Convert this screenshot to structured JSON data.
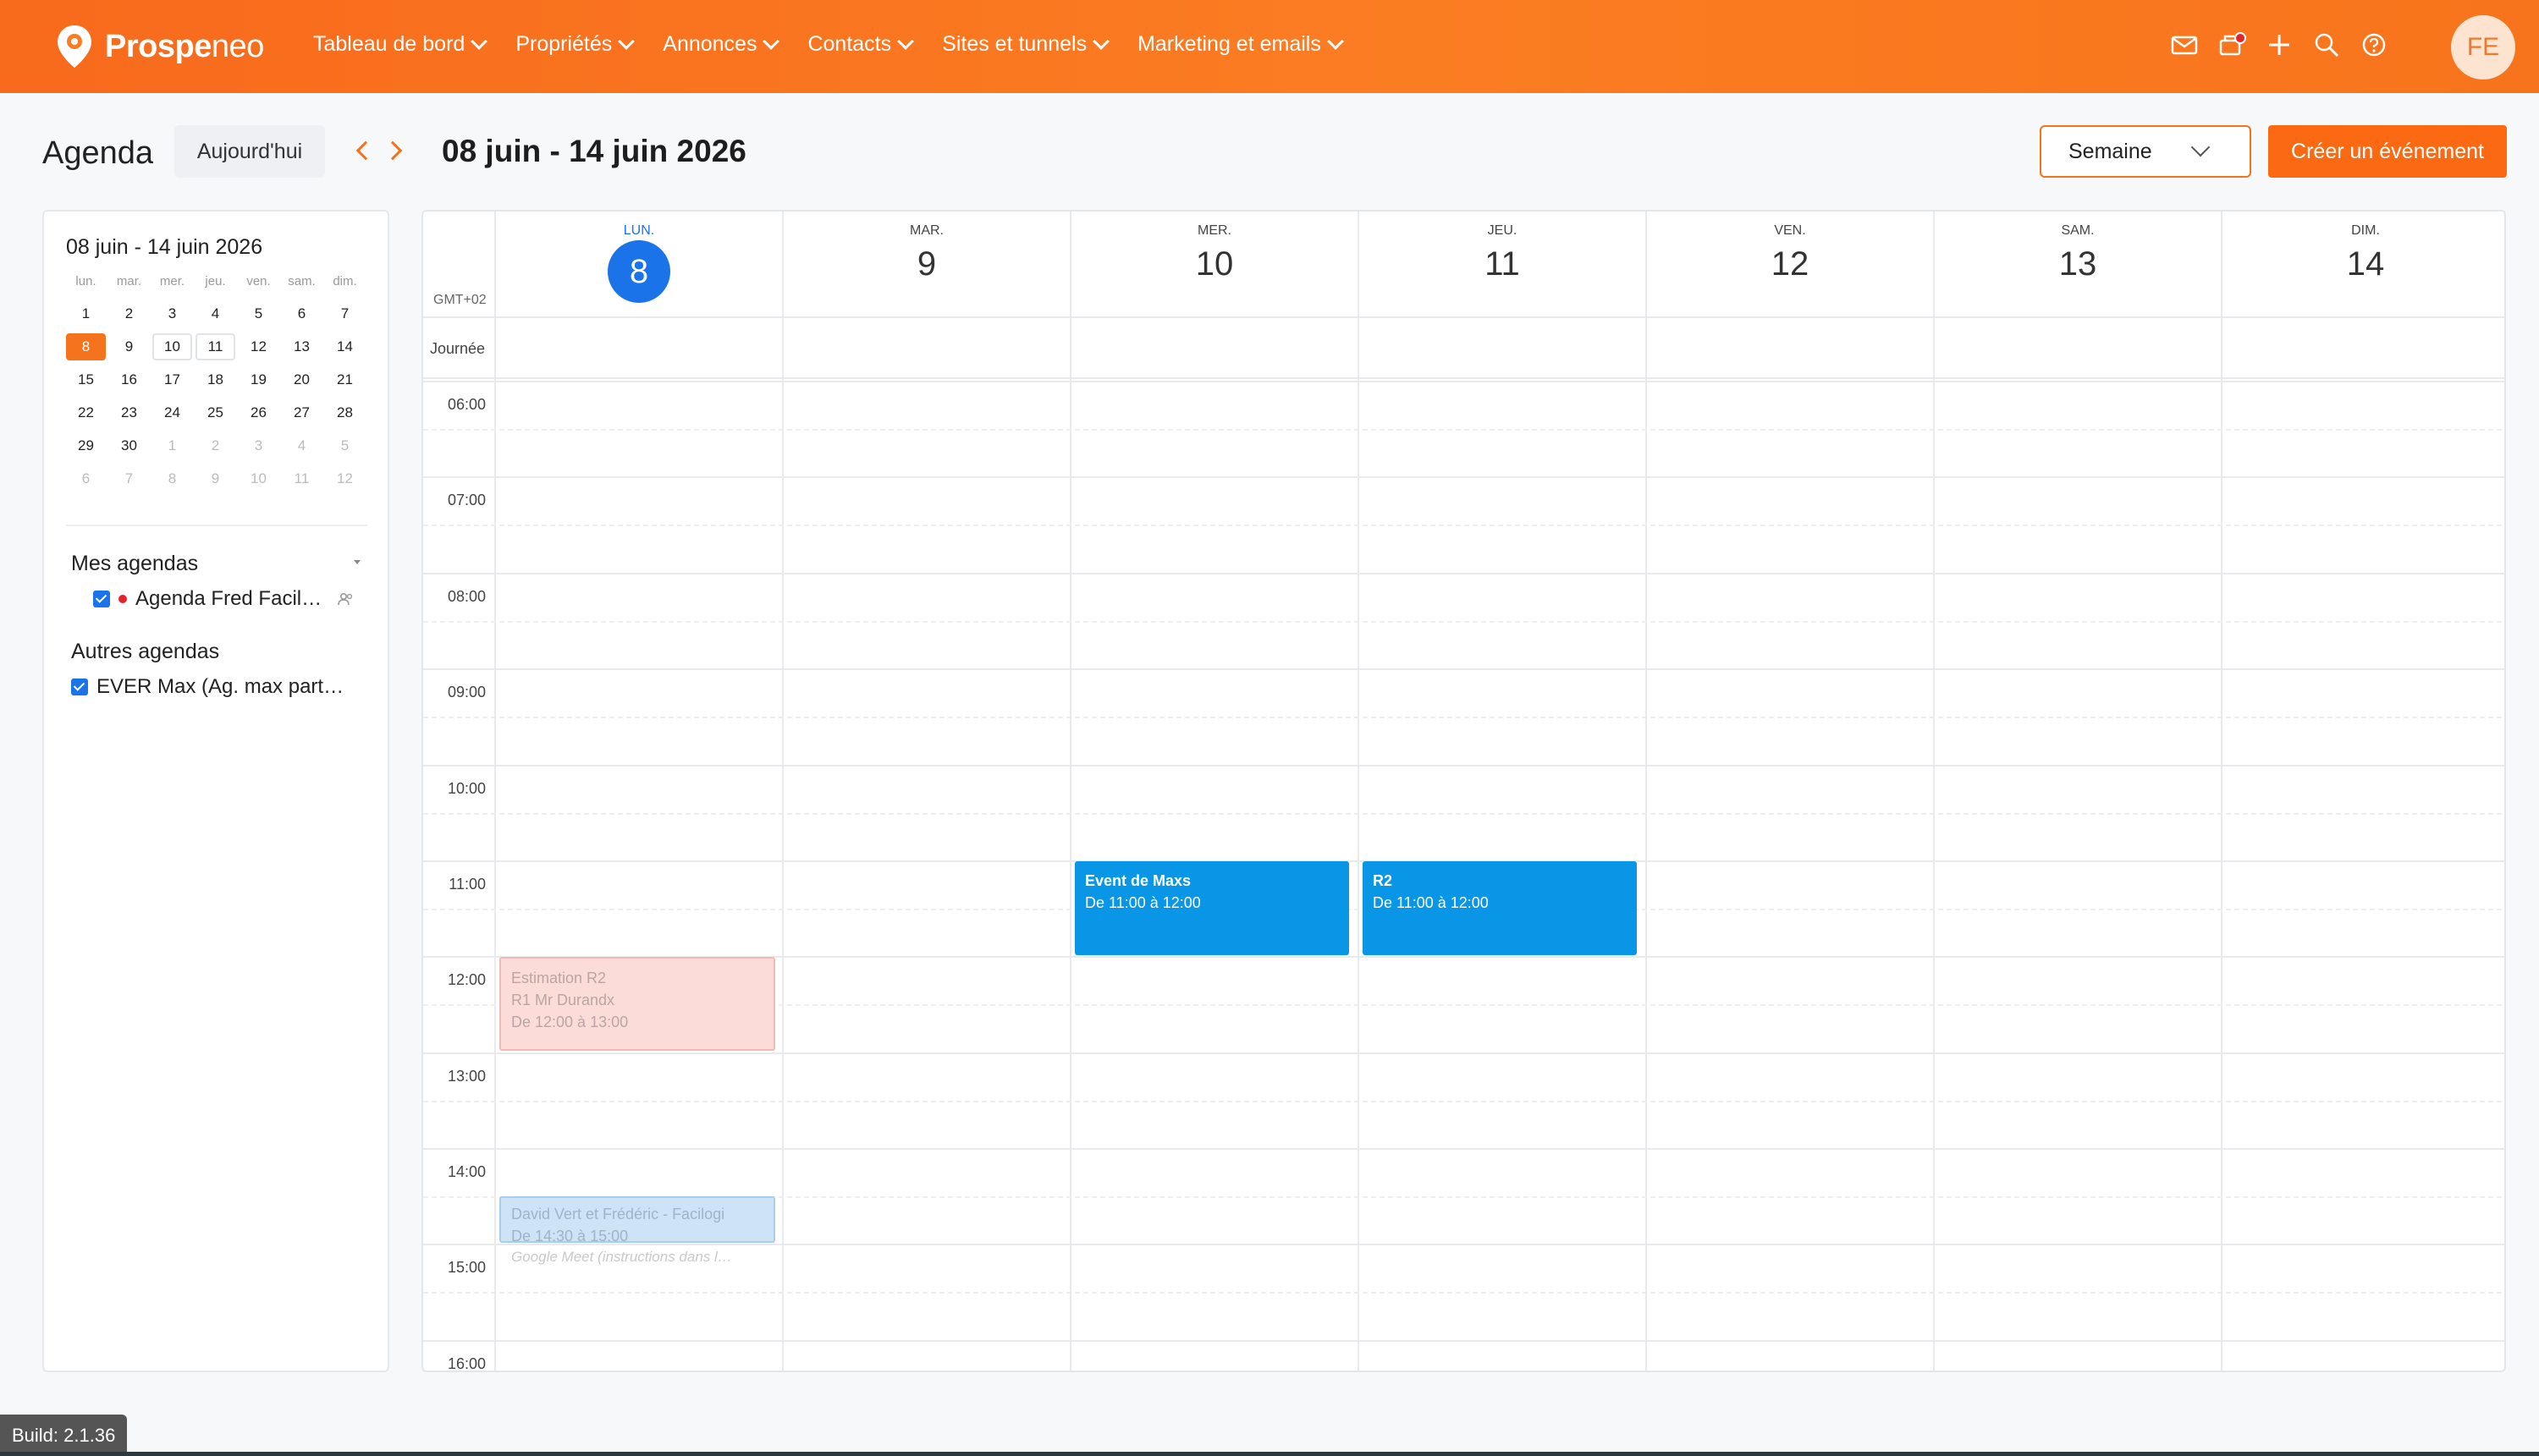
{
  "brand": {
    "name_bold": "Prospe",
    "name_light": "neo"
  },
  "nav": [
    {
      "label": "Tableau de bord"
    },
    {
      "label": "Propriétés"
    },
    {
      "label": "Annonces"
    },
    {
      "label": "Contacts"
    },
    {
      "label": "Sites et tunnels"
    },
    {
      "label": "Marketing et emails"
    }
  ],
  "user": {
    "initials": "FE"
  },
  "header": {
    "title": "Agenda",
    "today_label": "Aujourd'hui",
    "range_label": "08 juin - 14 juin 2026",
    "view_label": "Semaine",
    "create_label": "Créer un événement"
  },
  "mini_calendar": {
    "title": "08 juin - 14 juin 2026",
    "dow": [
      "lun.",
      "mar.",
      "mer.",
      "jeu.",
      "ven.",
      "sam.",
      "dim."
    ],
    "weeks": [
      [
        "1",
        "2",
        "3",
        "4",
        "5",
        "6",
        "7"
      ],
      [
        "8",
        "9",
        "10",
        "11",
        "12",
        "13",
        "14"
      ],
      [
        "15",
        "16",
        "17",
        "18",
        "19",
        "20",
        "21"
      ],
      [
        "22",
        "23",
        "24",
        "25",
        "26",
        "27",
        "28"
      ],
      [
        "29",
        "30",
        "1",
        "2",
        "3",
        "4",
        "5"
      ],
      [
        "6",
        "7",
        "8",
        "9",
        "10",
        "11",
        "12"
      ]
    ]
  },
  "my_calendars": {
    "title": "Mes agendas",
    "items": [
      {
        "label": "Agenda Fred Facil…"
      }
    ]
  },
  "other_calendars": {
    "title": "Autres agendas",
    "items": [
      {
        "label": "EVER Max (Ag. max part…"
      }
    ]
  },
  "week": {
    "timezone": "GMT+02",
    "allday_label": "Journée",
    "days": [
      {
        "dow": "LUN.",
        "num": "8",
        "active": true
      },
      {
        "dow": "MAR.",
        "num": "9"
      },
      {
        "dow": "MER.",
        "num": "10"
      },
      {
        "dow": "JEU.",
        "num": "11"
      },
      {
        "dow": "VEN.",
        "num": "12"
      },
      {
        "dow": "SAM.",
        "num": "13"
      },
      {
        "dow": "DIM.",
        "num": "14"
      }
    ],
    "hours": [
      "06:00",
      "07:00",
      "08:00",
      "09:00",
      "10:00",
      "11:00",
      "12:00",
      "13:00",
      "14:00",
      "15:00",
      "16:00"
    ]
  },
  "events": {
    "maxs": {
      "title": "Event de Maxs",
      "time": "De 11:00 à 12:00"
    },
    "r2": {
      "title": "R2",
      "time": "De 11:00 à 12:00"
    },
    "estimation": {
      "title": "Estimation R2",
      "subtitle": "R1 Mr Durandx",
      "time": "De 12:00 à 13:00"
    },
    "david": {
      "title": "David Vert et Frédéric - Facilogi",
      "time": "De 14:30 à 15:00",
      "extra": "Google Meet (instructions dans l…"
    }
  },
  "build": {
    "label": "Build: 2.1.36"
  }
}
